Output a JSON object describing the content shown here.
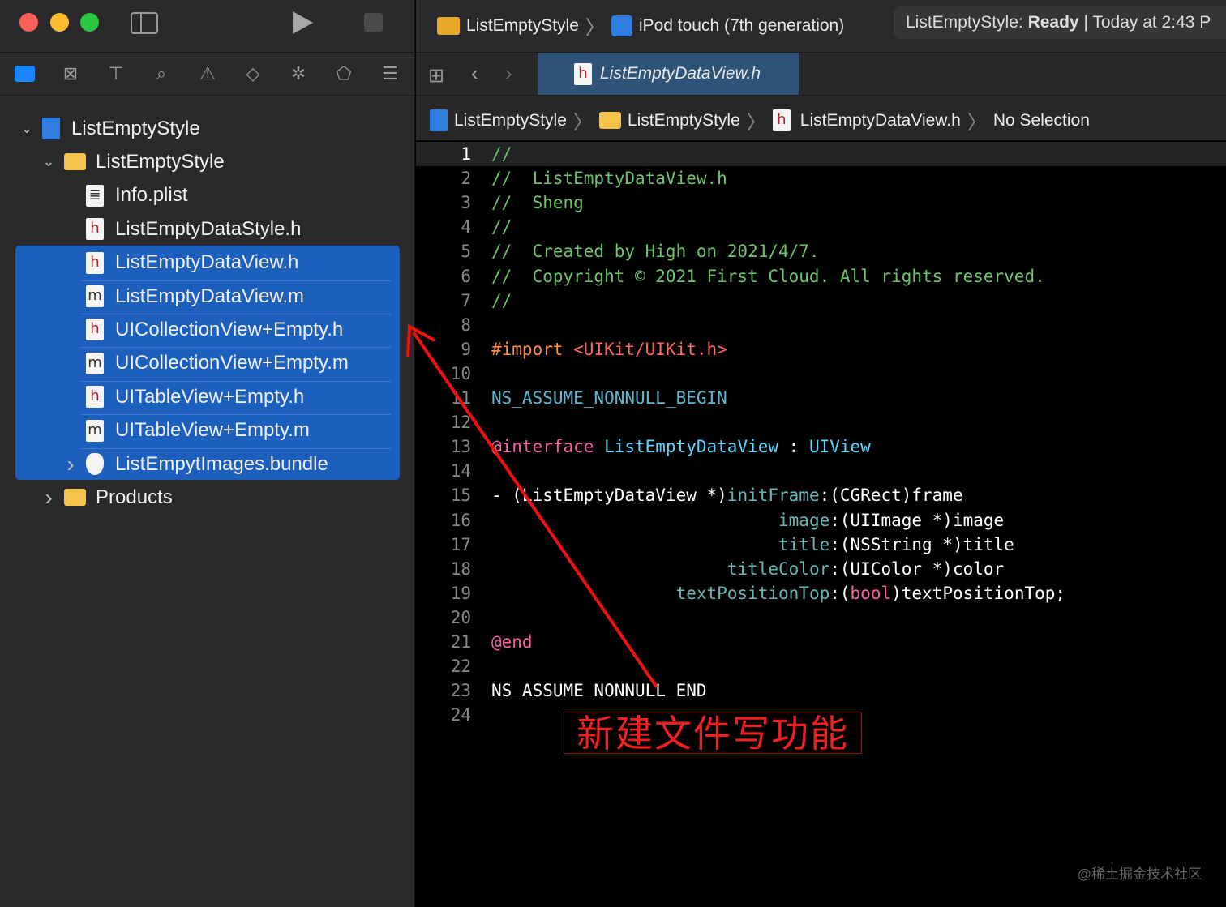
{
  "toolbar": {
    "scheme": "ListEmptyStyle",
    "device": "iPod touch (7th generation)",
    "status_prefix": "ListEmptyStyle: ",
    "status_state": "Ready",
    "status_time": "| Today at 2:43 P"
  },
  "navigator_icons": [
    "folder-icon",
    "source-control-icon",
    "hierarchy-icon",
    "search-icon",
    "warning-icon",
    "test-icon",
    "debug-icon",
    "breakpoint-icon",
    "report-icon"
  ],
  "tree": [
    {
      "label": "ListEmptyStyle",
      "kind": "project",
      "level": 0,
      "expanded": true
    },
    {
      "label": "ListEmptyStyle",
      "kind": "folder",
      "level": 1,
      "expanded": true
    },
    {
      "label": "Info.plist",
      "kind": "plist",
      "level": 2
    },
    {
      "label": "ListEmptyDataStyle.h",
      "kind": "h",
      "level": 2
    },
    {
      "label": "ListEmptyDataView.h",
      "kind": "h",
      "level": 2,
      "selected": true
    },
    {
      "label": "ListEmptyDataView.m",
      "kind": "m",
      "level": 2,
      "selected": true
    },
    {
      "label": "UICollectionView+Empty.h",
      "kind": "h",
      "level": 2,
      "selected": true
    },
    {
      "label": "UICollectionView+Empty.m",
      "kind": "m",
      "level": 2,
      "selected": true
    },
    {
      "label": "UITableView+Empty.h",
      "kind": "h",
      "level": 2,
      "selected": true
    },
    {
      "label": "UITableView+Empty.m",
      "kind": "m",
      "level": 2,
      "selected": true
    },
    {
      "label": "ListEmpytImages.bundle",
      "kind": "bundle",
      "level": 2,
      "selected": true,
      "collapsed": true
    },
    {
      "label": "Products",
      "kind": "folder",
      "level": 1,
      "collapsed": true
    }
  ],
  "tab": {
    "label": "ListEmptyDataView.h"
  },
  "jumpbar": {
    "project": "ListEmptyStyle",
    "group": "ListEmptyStyle",
    "file": "ListEmptyDataView.h",
    "selection": "No Selection"
  },
  "code": [
    [
      [
        "//",
        "com"
      ]
    ],
    [
      [
        "//  ListEmptyDataView.h",
        "com"
      ]
    ],
    [
      [
        "//  Sheng",
        "com"
      ]
    ],
    [
      [
        "//",
        "com"
      ]
    ],
    [
      [
        "//  Created by High on 2021/4/7.",
        "com"
      ]
    ],
    [
      [
        "//  Copyright © 2021 First Cloud. All rights reserved.",
        "com"
      ]
    ],
    [
      [
        "//",
        "com"
      ]
    ],
    [],
    [
      [
        "#import ",
        "pre"
      ],
      [
        "<UIKit/UIKit.h>",
        "str"
      ]
    ],
    [],
    [
      [
        "NS_ASSUME_NONNULL_BEGIN",
        "mac"
      ]
    ],
    [],
    [
      [
        "@interface ",
        "kw"
      ],
      [
        "ListEmptyDataView",
        "cls"
      ],
      [
        " : ",
        "pl"
      ],
      [
        "UIView",
        "cls"
      ]
    ],
    [],
    [
      [
        "- (ListEmptyDataView *)",
        "pl"
      ],
      [
        "initFrame",
        "fn"
      ],
      [
        ":(CGRect)frame",
        "pl"
      ]
    ],
    [
      [
        "                            ",
        "pl"
      ],
      [
        "image",
        "fn"
      ],
      [
        ":(UIImage *)image",
        "pl"
      ]
    ],
    [
      [
        "                            ",
        "pl"
      ],
      [
        "title",
        "fn"
      ],
      [
        ":(NSString *)title",
        "pl"
      ]
    ],
    [
      [
        "                       ",
        "pl"
      ],
      [
        "titleColor",
        "fn"
      ],
      [
        ":(UIColor *)color",
        "pl"
      ]
    ],
    [
      [
        "                  ",
        "pl"
      ],
      [
        "textPositionTop",
        "fn"
      ],
      [
        ":(",
        "pl"
      ],
      [
        "bool",
        "kw"
      ],
      [
        ")textPositionTop;",
        "pl"
      ]
    ],
    [],
    [
      [
        "@end",
        "kw"
      ]
    ],
    [],
    [
      [
        "NS_ASSUME_NONNULL_END",
        "pl"
      ]
    ],
    []
  ],
  "annotation": "新建文件写功能",
  "watermark": "@稀土掘金技术社区"
}
